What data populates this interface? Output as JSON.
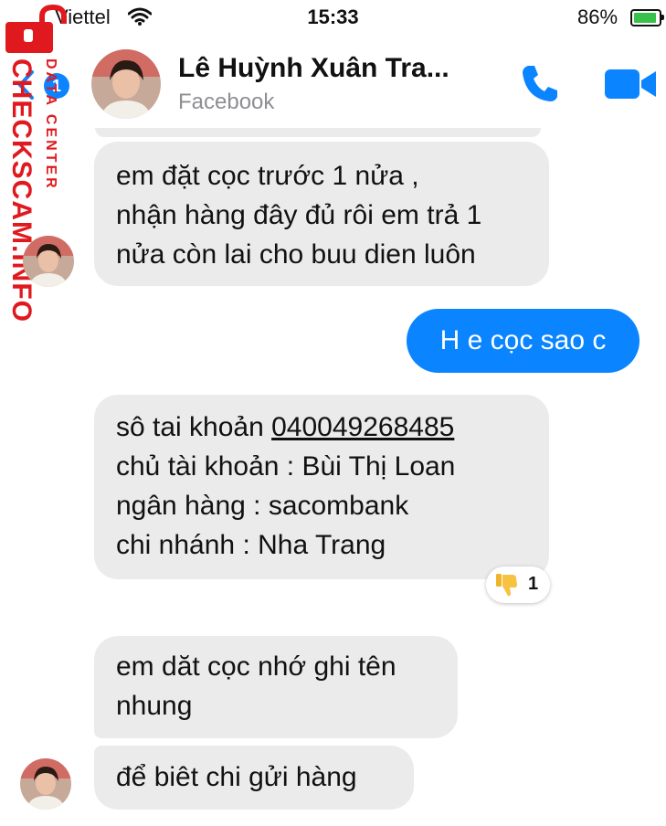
{
  "status_bar": {
    "carrier": "Viettel",
    "time": "15:33",
    "battery": "86%",
    "battery_level": 0.86
  },
  "header": {
    "back_badge": "1",
    "contact_name": "Lê Huỳnh Xuân Tra...",
    "subtitle": "Facebook",
    "call_icon": "phone-icon",
    "video_icon": "video-camera-icon",
    "accent_color": "#0a84ff"
  },
  "watermark": {
    "label": "DATA CENTER",
    "site": "CHECKSCAM.INFO",
    "color": "#e0191f"
  },
  "messages": [
    {
      "direction": "incoming",
      "lines": [
        "em đặt cọc trước  1 nửa ,",
        "nhận hàng đây đủ rôi em trả 1",
        "nửa còn lai cho buu dien luôn"
      ]
    },
    {
      "direction": "outgoing",
      "lines": [
        "H e cọc sao c"
      ]
    },
    {
      "direction": "incoming",
      "lines": [
        "sô tai khoản ",
        "040049268485",
        "chủ tài khoản : Bùi Thị Loan",
        "ngân hàng : sacombank",
        "chi nhánh : Nha Trang"
      ],
      "reaction": {
        "icon": "thumbs-down-icon",
        "count": "1"
      }
    },
    {
      "direction": "incoming",
      "lines": [
        "em dăt cọc nhớ ghi tên",
        "nhung"
      ]
    },
    {
      "direction": "incoming",
      "lines": [
        "để biêt chi gửi hàng"
      ]
    }
  ]
}
